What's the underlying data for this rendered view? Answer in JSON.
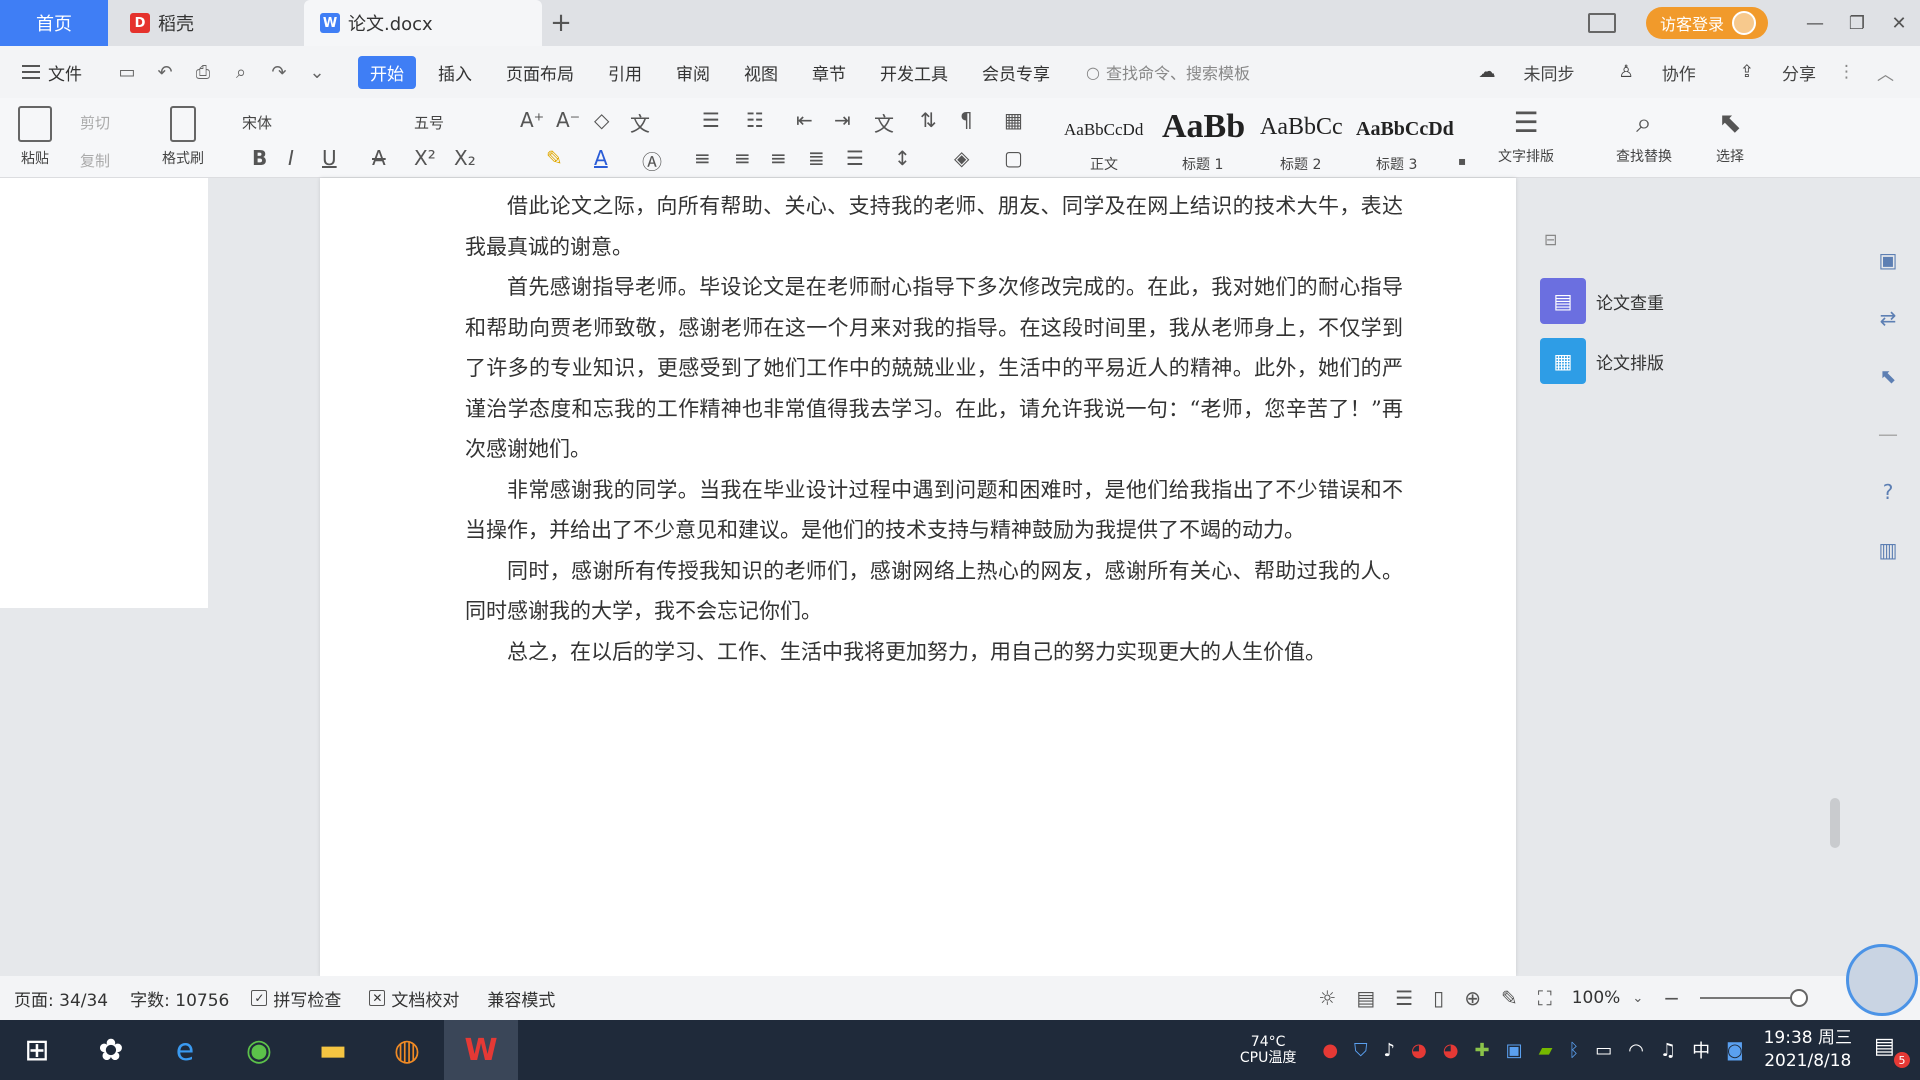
{
  "tabs": {
    "home": "首页",
    "daoke": "稻壳",
    "document": "论文.docx",
    "new_tab": "+"
  },
  "window": {
    "login": "访客登录",
    "minimize": "—",
    "restore": "❐",
    "close": "✕"
  },
  "menu": {
    "file": "文件",
    "items": [
      "开始",
      "插入",
      "页面布局",
      "引用",
      "审阅",
      "视图",
      "章节",
      "开发工具",
      "会员专享"
    ],
    "active": "开始",
    "search": "查找命令、搜索模板",
    "unsync": "未同步",
    "collab": "协作",
    "share": "分享"
  },
  "ribbon": {
    "paste": "粘贴",
    "cut": "剪切",
    "copy": "复制",
    "format_painter": "格式刷",
    "font_name": "宋体",
    "font_size": "五号",
    "styles": [
      {
        "preview": "AaBbCcDd",
        "label": "正文"
      },
      {
        "preview": "AaBb",
        "label": "标题 1"
      },
      {
        "preview": "AaBbCc",
        "label": "标题 2"
      },
      {
        "preview": "AaBbCcDd",
        "label": "标题 3"
      }
    ],
    "text_layout": "文字排版",
    "find_replace": "查找替换",
    "select": "选择"
  },
  "document": {
    "paragraphs": [
      "借此论文之际，向所有帮助、关心、支持我的老师、朋友、同学及在网上结识的技术大牛，表达我最真诚的谢意。",
      "首先感谢指导老师。毕设论文是在老师耐心指导下多次修改完成的。在此，我对她们的耐心指导和帮助向贾老师致敬，感谢老师在这一个月来对我的指导。在这段时间里，我从老师身上，不仅学到了许多的专业知识，更感受到了她们工作中的兢兢业业，生活中的平易近人的精神。此外，她们的严谨治学态度和忘我的工作精神也非常值得我去学习。在此，请允许我说一句：“老师，您辛苦了！”再次感谢她们。",
      "非常感谢我的同学。当我在毕业设计过程中遇到问题和困难时，是他们给我指出了不少错误和不当操作，并给出了不少意见和建议。是他们的技术支持与精神鼓励为我提供了不竭的动力。",
      "同时，感谢所有传授我知识的老师们，感谢网络上热心的网友，感谢所有关心、帮助过我的人。同时感谢我的大学，我不会忘记你们。",
      "总之，在以后的学习、工作、生活中我将更加努力，用自己的努力实现更大的人生价值。"
    ]
  },
  "right_panel": {
    "items": [
      {
        "label": "论文查重",
        "color": "#6b6fe0"
      },
      {
        "label": "论文排版",
        "color": "#2e9de6"
      }
    ]
  },
  "status": {
    "page": "页面: 34/34",
    "words": "字数: 10756",
    "spell": "拼写检查",
    "proof": "文档校对",
    "compat": "兼容模式",
    "zoom": "100%",
    "zoom_level": 1.0
  },
  "taskbar": {
    "cpu_temp": "74°C",
    "cpu_label": "CPU温度",
    "ime": "中",
    "time": "19:38 周三",
    "date": "2021/8/18",
    "notifications": "5"
  },
  "colors": {
    "accent": "#3f7ef5",
    "login": "#f19a2b",
    "taskbar": "#1f2a3a"
  }
}
